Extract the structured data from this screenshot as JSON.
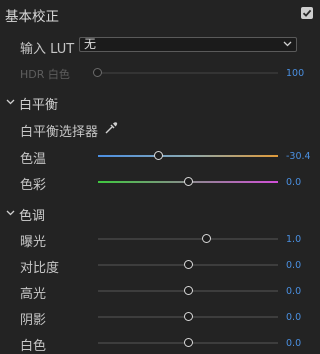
{
  "panel": {
    "title": "基本校正",
    "enabled": true
  },
  "input_lut": {
    "label": "输入 LUT",
    "value": "无"
  },
  "hdr_white": {
    "label": "HDR 白色",
    "value": "100",
    "level_fraction": 0.0,
    "disabled": true
  },
  "white_balance": {
    "title": "白平衡",
    "picker_label": "白平衡选择器",
    "temperature": {
      "label": "色温",
      "value": "-30.4",
      "level_fraction": 0.34
    },
    "tint": {
      "label": "色彩",
      "value": "0.0",
      "level_fraction": 0.5
    }
  },
  "tone": {
    "title": "色调",
    "exposure": {
      "label": "曝光",
      "value": "1.0",
      "level_fraction": 0.6
    },
    "contrast": {
      "label": "对比度",
      "value": "0.0",
      "level_fraction": 0.5
    },
    "highlights": {
      "label": "高光",
      "value": "0.0",
      "level_fraction": 0.5
    },
    "shadows": {
      "label": "阴影",
      "value": "0.0",
      "level_fraction": 0.5
    },
    "whites": {
      "label": "白色",
      "value": "0.0",
      "level_fraction": 0.5
    }
  },
  "colors": {
    "accent": "#4a8fe0",
    "temp_cold": "#4b8fe3",
    "temp_warm": "#e09a3a",
    "tint_green": "#3fc83f",
    "tint_magenta": "#d24fd8"
  }
}
